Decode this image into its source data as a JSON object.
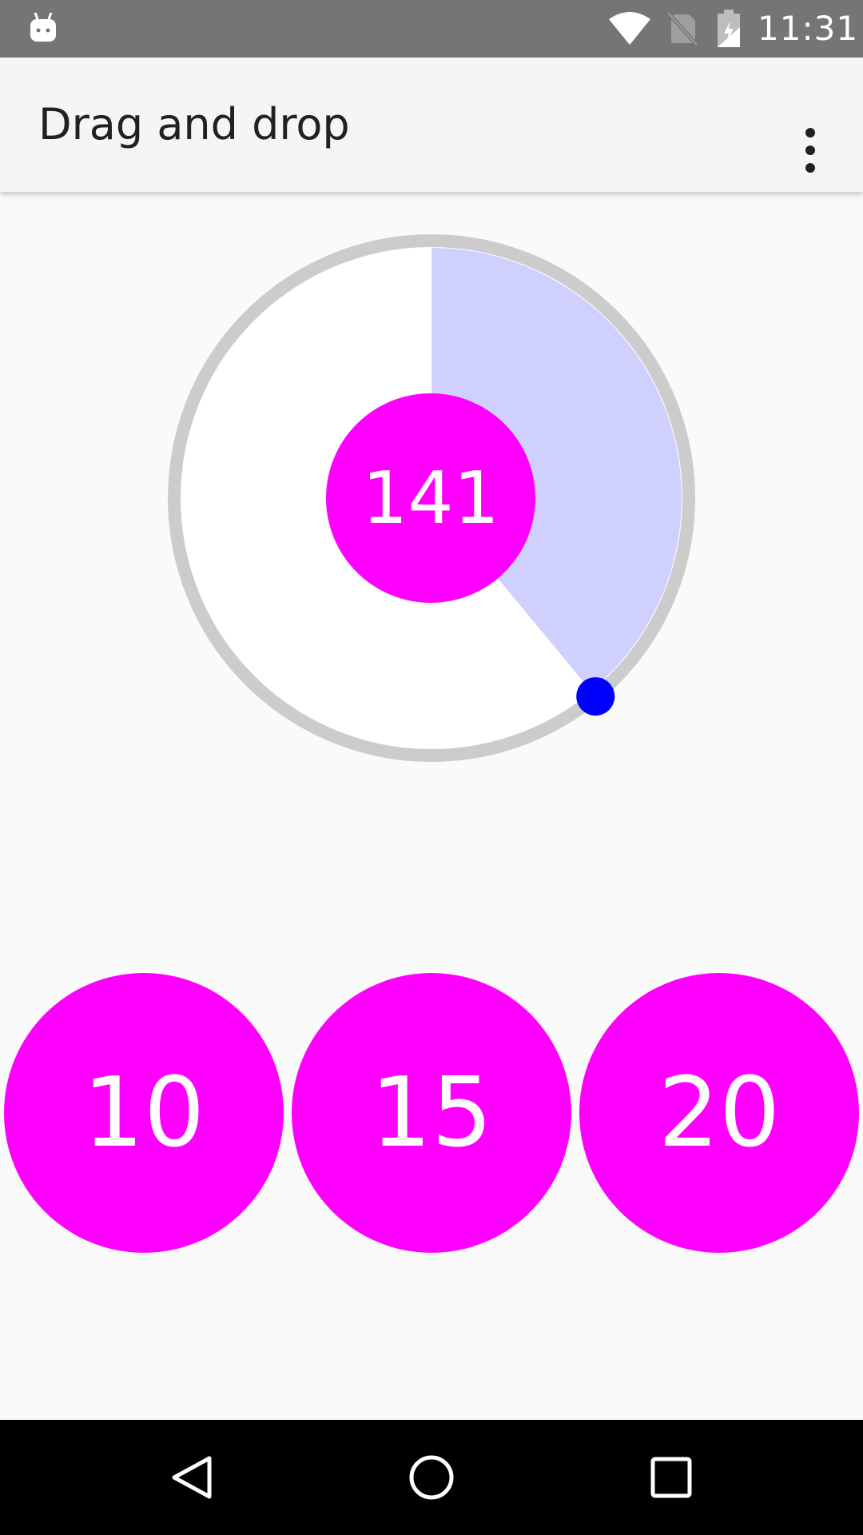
{
  "status_bar": {
    "time": "11:31",
    "icons": [
      "android-icon",
      "wifi-icon",
      "no-sim-icon",
      "battery-charging-icon"
    ]
  },
  "app_bar": {
    "title": "Drag and drop",
    "menu_icon": "overflow-menu-icon"
  },
  "dial": {
    "value": "141",
    "fill_fraction": 0.39,
    "colors": {
      "track": "#cccccc",
      "face": "#ffffff",
      "fill": "#d0d0ff",
      "handle": "#0000ff",
      "center": "#ff00ff"
    }
  },
  "presets": [
    {
      "label": "10"
    },
    {
      "label": "15"
    },
    {
      "label": "20"
    }
  ],
  "nav_bar": {
    "icons": [
      "back-icon",
      "home-icon",
      "recents-icon"
    ]
  }
}
